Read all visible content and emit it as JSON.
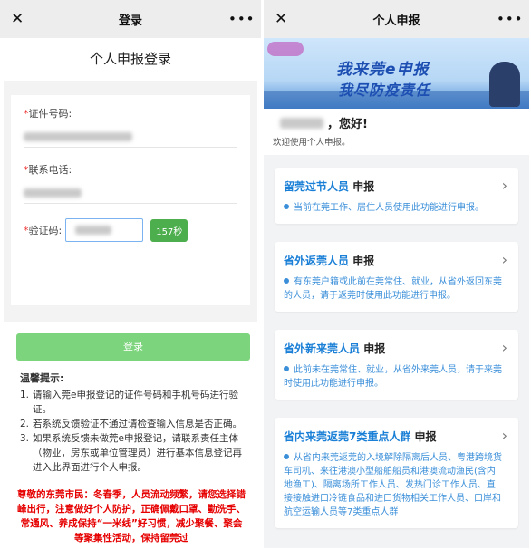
{
  "left": {
    "topbar": {
      "close": "✕",
      "title": "登录",
      "more": "•••"
    },
    "heading": "个人申报登录",
    "fields": {
      "id_label": "证件号码:",
      "phone_label": "联系电话:",
      "code_label": "验证码:",
      "required_mark": "*"
    },
    "code_button": "157秒",
    "login_button": "登录",
    "tips": {
      "title": "温馨提示:",
      "items": [
        {
          "n": "1.",
          "text": "请输入莞e申报登记的证件号码和手机号码进行验证。"
        },
        {
          "n": "2.",
          "text": "若系统反馈验证不通过请检查输入信息是否正确。"
        },
        {
          "n": "3.",
          "text": "如果系统反馈未做莞e申报登记，请联系责任主体（物业，房东或单位管理员）进行基本信息登记再进入此界面进行个人申报。"
        }
      ]
    },
    "notice": "尊敬的东莞市民：冬春季，人员流动频繁，请您选择错峰出行，注意做好个人防护，正确佩戴口罩、勤洗手、常通风、养成保持“一米线”好习惯，减少聚餐、聚会等聚集性活动，保持留莞过"
  },
  "right": {
    "topbar": {
      "close": "✕",
      "title": "个人申报",
      "more": "•••"
    },
    "banner": {
      "line1": "我来莞e申报",
      "line2": "我尽防疫责任"
    },
    "greeting": "，您好!",
    "welcome": "欢迎使用个人申报。",
    "cards": [
      {
        "title_blue": "留莞过节人员",
        "title_black": " 申报",
        "desc": "当前在莞工作、居住人员使用此功能进行申报。"
      },
      {
        "title_blue": "省外返莞人员",
        "title_black": " 申报",
        "desc": "有东莞户籍或此前在莞常住、就业，从省外返回东莞的人员，请于返莞时使用此功能进行申报。"
      },
      {
        "title_blue": "省外新来莞人员",
        "title_black": " 申报",
        "desc": "此前未在莞常住、就业，从省外来莞人员，请于来莞时使用此功能进行申报。"
      },
      {
        "title_blue": "省内来莞返莞7类重点人群",
        "title_black": " 申报",
        "desc": "从省内来莞返莞的入境解除隔离后人员、粤港跨境货车司机、来往港澳小型船舶船员和港澳流动渔民(含内地渔工)、隔离场所工作人员、发热门诊工作人员、直接接触进口冷链食品和进口货物相关工作人员、口岸和航空运输人员等7类重点人群"
      }
    ],
    "chevron": "›"
  }
}
